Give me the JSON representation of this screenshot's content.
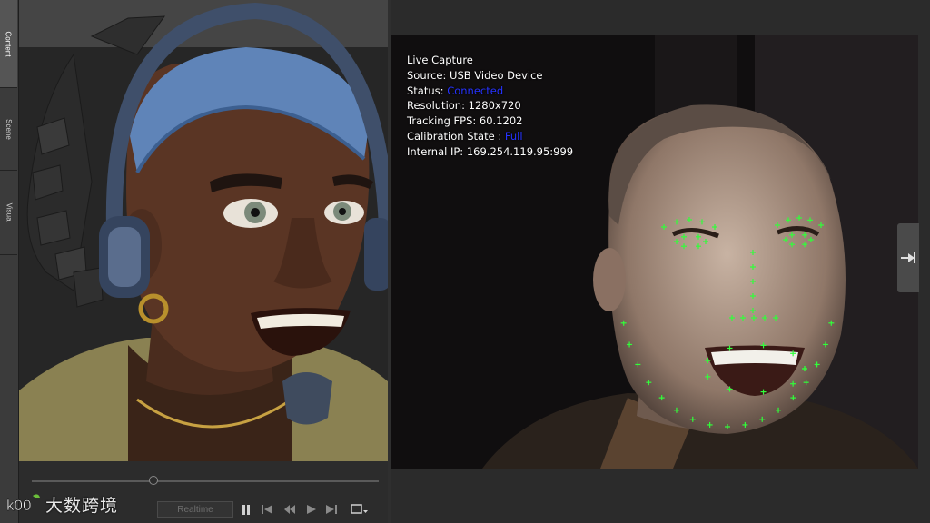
{
  "side_tabs": [
    {
      "label": "Content",
      "active": true
    },
    {
      "label": "Scene",
      "active": false
    },
    {
      "label": "Visual",
      "active": false
    }
  ],
  "timeline": {
    "realtime_label": "Realtime",
    "position": 0.35
  },
  "transport_icons": [
    "pause-icon",
    "step-back-icon",
    "rewind-icon",
    "play-icon",
    "step-forward-icon",
    "camera-menu-icon"
  ],
  "camera": {
    "overlay": {
      "title": "Live Capture",
      "source_label": "Source:",
      "source_value": "USB Video Device",
      "status_label": "Status:",
      "status_value": "Connected",
      "resolution_label": "Resolution:",
      "resolution_value": "1280x720",
      "fps_label": "Tracking FPS:",
      "fps_value": "60.1202",
      "calibration_label": "Calibration State :",
      "calibration_value": "Full",
      "ip_label": "Internal IP:",
      "ip_value": "169.254.119.95:999"
    }
  },
  "watermark": {
    "logo_text": "k00",
    "text": "大数跨境"
  },
  "colors": {
    "status_blue": "#2633ff",
    "tracking_green": "#31ff3a",
    "panel_bg": "#2f2f2f"
  }
}
